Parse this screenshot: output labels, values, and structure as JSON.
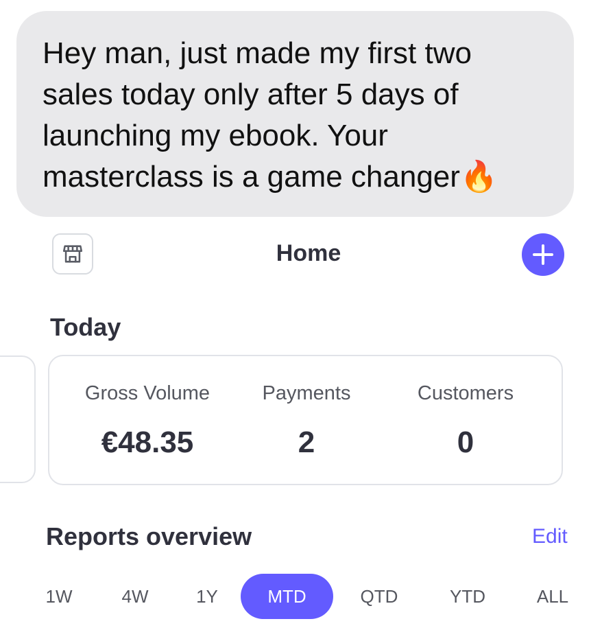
{
  "message": {
    "text": "Hey man, just made my first two\nsales today only after 5 days of\nlaunching my ebook. Your\nmasterclass is a game changer",
    "emoji": "🔥"
  },
  "header": {
    "title": "Home",
    "left_icon": "storefront-icon",
    "right_icon": "plus-icon"
  },
  "today": {
    "heading": "Today",
    "stats": [
      {
        "label": "Gross Volume",
        "value": "€48.35"
      },
      {
        "label": "Payments",
        "value": "2"
      },
      {
        "label": "Customers",
        "value": "0"
      }
    ]
  },
  "reports": {
    "heading": "Reports overview",
    "edit_label": "Edit",
    "ranges": [
      "1W",
      "4W",
      "1Y",
      "MTD",
      "QTD",
      "YTD",
      "ALL"
    ],
    "selected_range": "MTD"
  },
  "colors": {
    "accent": "#635bff",
    "bubble": "#e9e9eb",
    "text_dark": "#30313d",
    "text_muted": "#55575f"
  }
}
